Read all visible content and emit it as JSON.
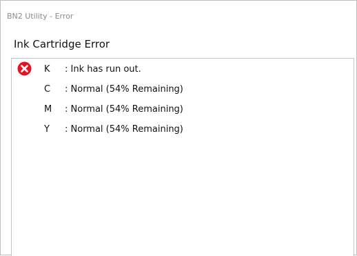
{
  "window": {
    "title": "BN2 Utility - Error"
  },
  "heading": "Ink Cartridge Error",
  "icons": {
    "error": "error-x-circle-icon"
  },
  "colors": {
    "error_red": "#e81123"
  },
  "cartridges": [
    {
      "color": "K",
      "status": ": Ink has run out.",
      "error": true
    },
    {
      "color": "C",
      "status": ": Normal (54% Remaining)",
      "error": false
    },
    {
      "color": "M",
      "status": ": Normal (54% Remaining)",
      "error": false
    },
    {
      "color": "Y",
      "status": ": Normal (54% Remaining)",
      "error": false
    }
  ]
}
